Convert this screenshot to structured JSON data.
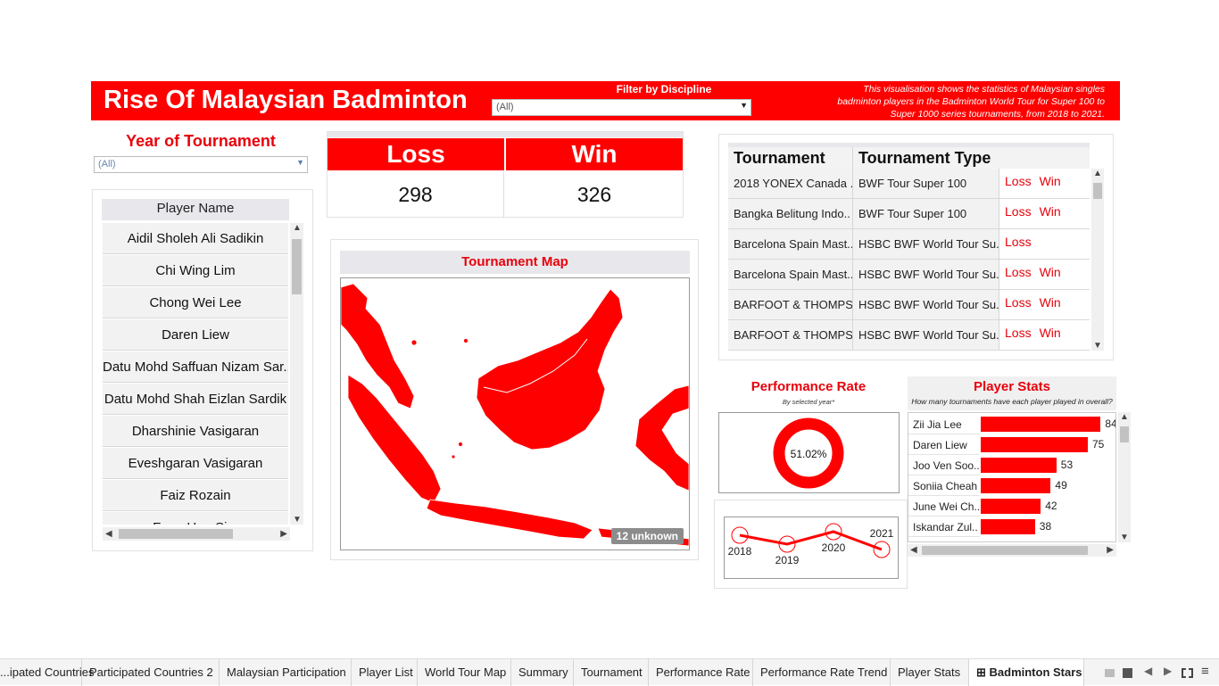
{
  "header": {
    "title": "Rise Of Malaysian Badminton",
    "filter_label": "Filter by Discipline",
    "filter_value": "(All)",
    "description": "This visualisation shows the statistics of Malaysian singles badminton players in the Badminton World Tour for Super 100 to Super 1000 series tournaments, from 2018 to 2021."
  },
  "year_filter": {
    "title": "Year of Tournament",
    "value": "(All)"
  },
  "players": {
    "header": "Player Name",
    "items": [
      "Aidil Sholeh Ali Sadikin",
      "Chi Wing Lim",
      "Chong Wei Lee",
      "Daren Liew",
      "Datu Mohd Saffuan Nizam Sar..",
      "Datu Mohd Shah Eizlan Sardik",
      "Dharshinie Vasigaran",
      "Eveshgaran Vasigaran",
      "Faiz Rozain",
      "Fong Hau Sim"
    ]
  },
  "kpi": {
    "loss_label": "Loss",
    "win_label": "Win",
    "loss_value": "298",
    "win_value": "326"
  },
  "map": {
    "title": "Tournament Map",
    "unknown_badge": "12 unknown"
  },
  "tournaments": {
    "col1": "Tournament",
    "col2": "Tournament Type",
    "rows": [
      {
        "name": "2018 YONEX Canada ..",
        "type": "BWF Tour Super 100",
        "loss": "Loss",
        "win": "Win"
      },
      {
        "name": "Bangka Belitung Indo..",
        "type": "BWF Tour Super 100",
        "loss": "Loss",
        "win": "Win"
      },
      {
        "name": "Barcelona Spain Mast..",
        "type": "HSBC BWF World Tour Su..",
        "loss": "Loss",
        "win": ""
      },
      {
        "name": "Barcelona Spain Mast..",
        "type": "HSBC BWF World Tour Su..",
        "loss": "Loss",
        "win": "Win"
      },
      {
        "name": "BARFOOT & THOMPS..",
        "type": "HSBC BWF World Tour Su..",
        "loss": "Loss",
        "win": "Win"
      },
      {
        "name": "BARFOOT & THOMPS..",
        "type": "HSBC BWF World Tour Su..",
        "loss": "Loss",
        "win": "Win"
      }
    ]
  },
  "performance": {
    "title": "Performance Rate",
    "subtitle": "By selected year*",
    "rate_label": "51.02%",
    "rate": 0.5102,
    "colors": {
      "accent": "#ff0000"
    }
  },
  "chart_data": [
    {
      "type": "line",
      "x": [
        "2018",
        "2019",
        "2020",
        "2021"
      ],
      "series": [
        {
          "values": [
            0.54,
            0.49,
            0.56,
            0.46
          ]
        }
      ]
    },
    {
      "type": "bar",
      "title": "Player Stats",
      "subtitle": "How many tournaments have each player played in overall?",
      "categories": [
        "Zii Jia Lee",
        "Daren Liew",
        "Joo Ven Soo..",
        "Soniia Cheah",
        "June Wei Ch..",
        "Iskandar Zul.."
      ],
      "values": [
        84,
        75,
        53,
        49,
        42,
        38
      ]
    }
  ],
  "tabs": [
    "...ipated Countries",
    "Participated Countries 2",
    "Malaysian Participation",
    "Player List",
    "World Tour Map",
    "Summary",
    "Tournament",
    "Performance Rate",
    "Performance Rate Trend",
    "Player Stats",
    "Badminton Stars"
  ]
}
